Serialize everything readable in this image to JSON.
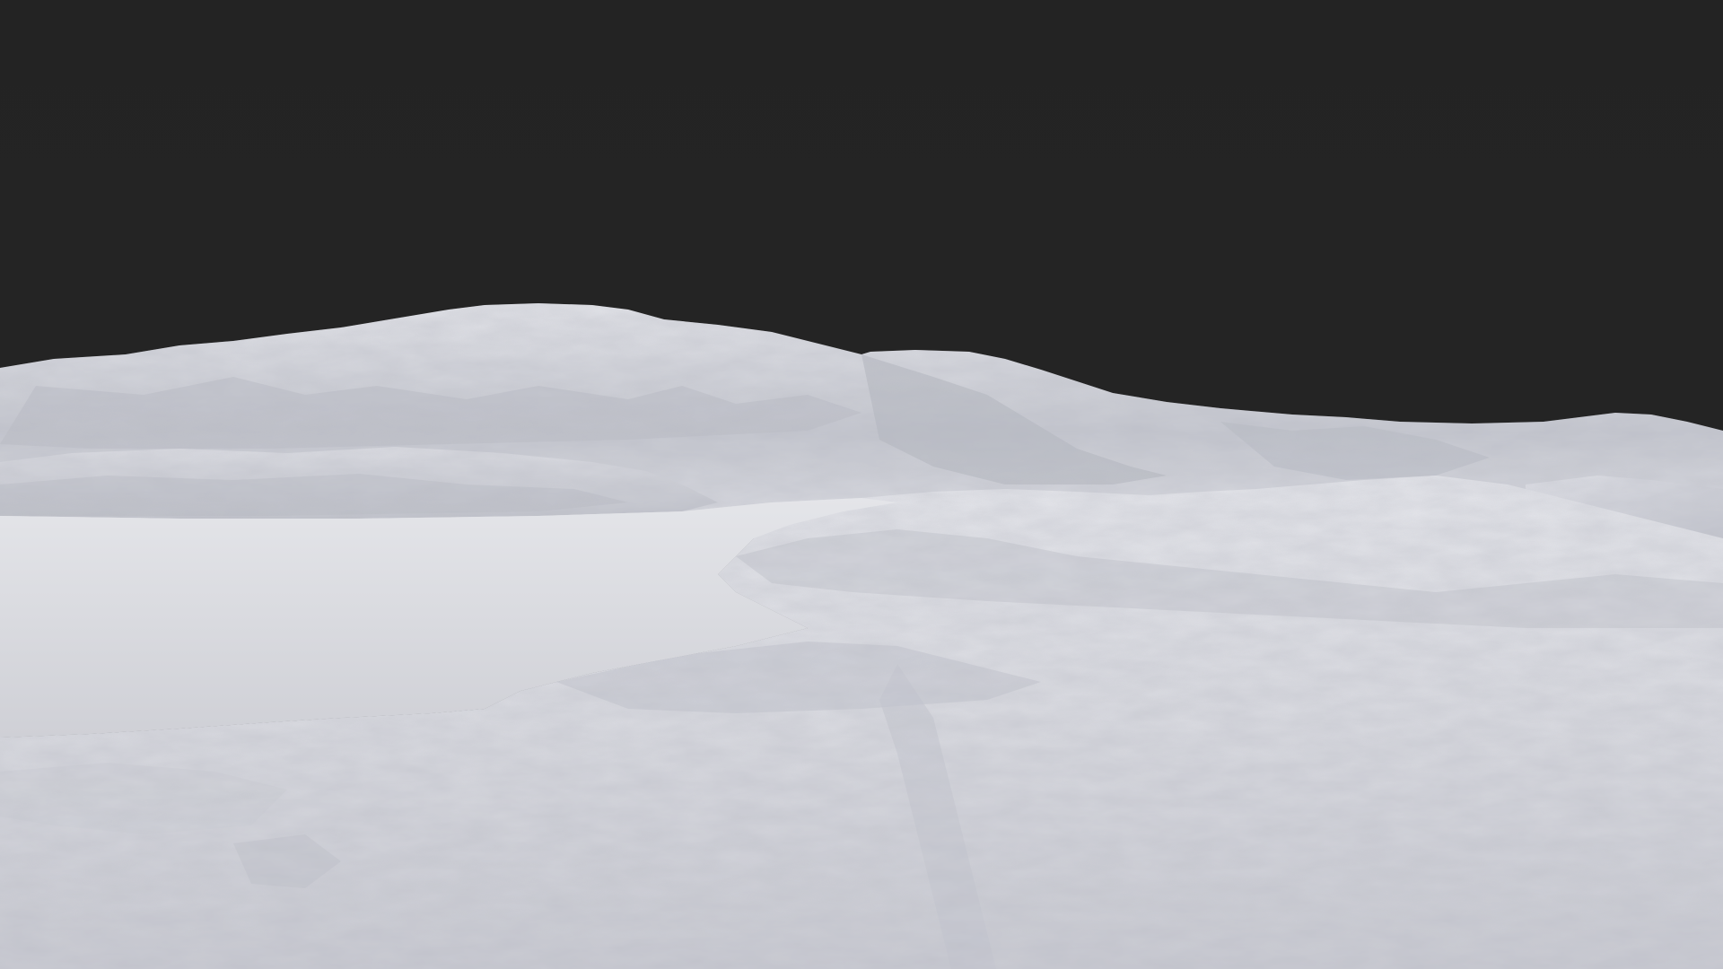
{
  "scene": {
    "kind": "rendered-terrain",
    "sky_color": "#222222",
    "snow_light": "#e8e9ee",
    "snow_mid": "#c9cbd3",
    "snow_shadow": "#9fa2ad",
    "lake_color": "#d9dadf"
  }
}
